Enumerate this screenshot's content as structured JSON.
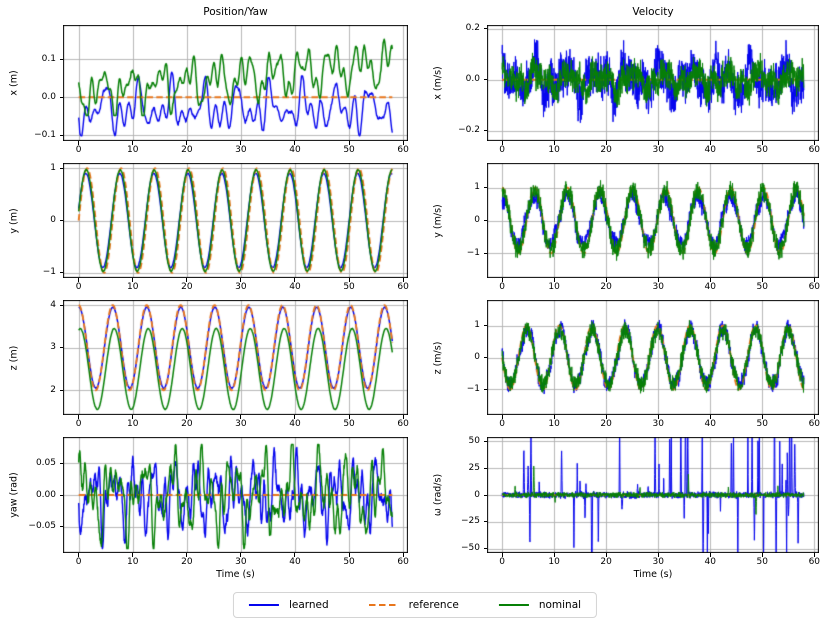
{
  "colors": {
    "learned": "#0505ee",
    "reference": "#e8761c",
    "nominal": "#078007",
    "grid": "#b0b0b0",
    "axis": "#000000"
  },
  "figure": {
    "xlabel": "Time (s)",
    "legend": [
      {
        "label": "learned",
        "color_key": "learned",
        "dashed": false
      },
      {
        "label": "reference",
        "color_key": "reference",
        "dashed": true
      },
      {
        "label": "nominal",
        "color_key": "nominal",
        "dashed": false
      }
    ]
  },
  "chart_data": [
    {
      "type": "line",
      "title": "Position/Yaw",
      "ylabel": "x (m)",
      "xlabel": null,
      "xlim": [
        -2.9,
        60.9
      ],
      "ylim": [
        -0.115,
        0.19
      ],
      "grid": true,
      "xticks": [
        0,
        10,
        20,
        30,
        40,
        50,
        60
      ],
      "yticks": [
        {
          "v": 0.1,
          "label": "0.1"
        },
        {
          "v": 0.0,
          "label": "0.0"
        },
        {
          "v": -0.1,
          "label": "−0.1"
        }
      ],
      "series": [
        {
          "name": "learned",
          "color_key": "learned",
          "width": 1.4,
          "dt": 0.1,
          "clamp": [
            -0.101,
            0.066
          ],
          "components": [
            {
              "type": "const",
              "value": -0.03
            },
            {
              "type": "wander",
              "amp": 0.04,
              "period": 6.2,
              "oct": 4,
              "seed": 11
            },
            {
              "type": "sine",
              "amp": 0.012,
              "omega": 1,
              "phase": 1.1
            },
            {
              "type": "noise",
              "amp": 0.003,
              "seed": 12
            }
          ]
        },
        {
          "name": "reference",
          "color_key": "reference",
          "width": 1.9,
          "dash": [
            6.5,
            3.2
          ],
          "dt": 0.5,
          "components": [
            {
              "type": "const",
              "value": 0
            }
          ]
        },
        {
          "name": "nominal",
          "color_key": "nominal",
          "width": 1.5,
          "dt": 0.1,
          "clamp": [
            -0.048,
            0.178
          ],
          "components": [
            {
              "type": "trend",
              "from": 0.01,
              "to": 0.09
            },
            {
              "type": "wander",
              "amp": 0.036,
              "period": 5.2,
              "oct": 4,
              "seed": 21
            },
            {
              "type": "noise",
              "amp": 0.003,
              "seed": 22
            }
          ]
        }
      ]
    },
    {
      "type": "line",
      "title": null,
      "ylabel": "y (m)",
      "xlabel": null,
      "xlim": [
        -2.9,
        60.9
      ],
      "ylim": [
        -1.1,
        1.1
      ],
      "grid": true,
      "xticks": [
        0,
        10,
        20,
        30,
        40,
        50,
        60
      ],
      "yticks": [
        {
          "v": 1,
          "label": "1"
        },
        {
          "v": 0,
          "label": "0"
        },
        {
          "v": -1,
          "label": "−1"
        }
      ],
      "series": [
        {
          "name": "learned",
          "color_key": "learned",
          "width": 1.4,
          "dt": 0.1,
          "components": [
            {
              "type": "sine",
              "amp": 0.9,
              "omega": 1,
              "phase": 0.25
            },
            {
              "type": "noise",
              "amp": 0.007,
              "seed": 31
            }
          ]
        },
        {
          "name": "reference",
          "color_key": "reference",
          "width": 1.9,
          "dash": [
            6.5,
            3.2
          ],
          "dt": 0.08,
          "components": [
            {
              "type": "sine",
              "amp": 1.0,
              "omega": 1,
              "phase": 0.0
            }
          ]
        },
        {
          "name": "nominal",
          "color_key": "nominal",
          "width": 1.5,
          "dt": 0.1,
          "components": [
            {
              "type": "sine",
              "amp": 0.97,
              "omega": 1,
              "phase": 0.18
            },
            {
              "type": "noise",
              "amp": 0.008,
              "seed": 32
            }
          ]
        }
      ]
    },
    {
      "type": "line",
      "title": null,
      "ylabel": "z (m)",
      "xlabel": null,
      "xlim": [
        -2.9,
        60.9
      ],
      "ylim": [
        1.42,
        4.12
      ],
      "grid": true,
      "xticks": [
        0,
        10,
        20,
        30,
        40,
        50,
        60
      ],
      "yticks": [
        {
          "v": 4,
          "label": "4"
        },
        {
          "v": 3,
          "label": "3"
        },
        {
          "v": 2,
          "label": "2"
        }
      ],
      "series": [
        {
          "name": "learned",
          "color_key": "learned",
          "width": 1.5,
          "dt": 0.1,
          "components": [
            {
              "type": "const",
              "value": 3
            },
            {
              "type": "sine",
              "amp": 0.95,
              "omega": 1,
              "phase": 1.53
            },
            {
              "type": "noise",
              "amp": 0.006,
              "seed": 33
            }
          ]
        },
        {
          "name": "reference",
          "color_key": "reference",
          "width": 1.9,
          "dash": [
            6.5,
            3.2
          ],
          "dt": 0.08,
          "components": [
            {
              "type": "const",
              "value": 3
            },
            {
              "type": "sine",
              "amp": 1.0,
              "omega": 1,
              "phase": 1.5708
            }
          ]
        },
        {
          "name": "nominal",
          "color_key": "nominal",
          "width": 1.5,
          "dt": 0.1,
          "components": [
            {
              "type": "const",
              "value": 2.5
            },
            {
              "type": "sine",
              "amp": 0.95,
              "omega": 1,
              "phase": 1.27
            },
            {
              "type": "noise",
              "amp": 0.006,
              "seed": 34
            }
          ]
        }
      ]
    },
    {
      "type": "line",
      "title": null,
      "ylabel": "yaw (rad)",
      "xlabel": "Time (s)",
      "xlim": [
        -2.9,
        60.9
      ],
      "ylim": [
        -0.092,
        0.092
      ],
      "grid": true,
      "xticks": [
        0,
        10,
        20,
        30,
        40,
        50,
        60
      ],
      "yticks": [
        {
          "v": 0.05,
          "label": "0.05"
        },
        {
          "v": 0.0,
          "label": "0.00"
        },
        {
          "v": -0.05,
          "label": "−0.05"
        }
      ],
      "series": [
        {
          "name": "learned",
          "color_key": "learned",
          "width": 1.4,
          "dt": 0.05,
          "clamp": [
            -0.085,
            0.083
          ],
          "components": [
            {
              "type": "wander",
              "amp": 0.03,
              "period": 4.2,
              "oct": 5,
              "seed": 41
            },
            {
              "type": "noise",
              "amp": 0.005,
              "seed": 42
            }
          ]
        },
        {
          "name": "reference",
          "color_key": "reference",
          "width": 1.9,
          "dash": [
            6.5,
            3.2
          ],
          "dt": 0.5,
          "components": [
            {
              "type": "const",
              "value": 0
            }
          ]
        },
        {
          "name": "nominal",
          "color_key": "nominal",
          "width": 1.4,
          "dt": 0.05,
          "clamp": [
            -0.085,
            0.08
          ],
          "components": [
            {
              "type": "wander",
              "amp": 0.034,
              "period": 4.8,
              "oct": 5,
              "seed": 51
            },
            {
              "type": "noise",
              "amp": 0.004,
              "seed": 52
            }
          ]
        }
      ]
    },
    {
      "type": "line",
      "title": "Velocity",
      "ylabel": "x (m/s)",
      "xlabel": null,
      "xlim": [
        -2.9,
        60.9
      ],
      "ylim": [
        -0.24,
        0.215
      ],
      "grid": true,
      "xticks": [
        0,
        10,
        20,
        30,
        40,
        50,
        60
      ],
      "yticks": [
        {
          "v": 0.2,
          "label": "0.2"
        },
        {
          "v": 0.0,
          "label": "0.0"
        },
        {
          "v": -0.2,
          "label": "−0.2"
        }
      ],
      "series": [
        {
          "name": "learned",
          "color_key": "learned",
          "width": 1.0,
          "dt": 0.04,
          "clamp": [
            -0.225,
            0.19
          ],
          "components": [
            {
              "type": "noise",
              "amp": 0.06,
              "seed": 61
            },
            {
              "type": "wander",
              "amp": 0.042,
              "period": 6.5,
              "oct": 3,
              "seed": 62
            }
          ]
        },
        {
          "name": "reference",
          "color_key": "reference",
          "width": 1.9,
          "dash": [
            6.5,
            3.2
          ],
          "dt": 0.5,
          "components": [
            {
              "type": "const",
              "value": 0
            }
          ]
        },
        {
          "name": "nominal",
          "color_key": "nominal",
          "width": 1.0,
          "dt": 0.04,
          "clamp": [
            -0.15,
            0.16
          ],
          "components": [
            {
              "type": "noise",
              "amp": 0.042,
              "seed": 71
            },
            {
              "type": "wander",
              "amp": 0.026,
              "period": 5.5,
              "oct": 3,
              "seed": 72
            }
          ]
        }
      ]
    },
    {
      "type": "line",
      "title": null,
      "ylabel": "y (m/s)",
      "xlabel": null,
      "xlim": [
        -2.9,
        60.9
      ],
      "ylim": [
        -1.75,
        1.75
      ],
      "grid": true,
      "xticks": [
        0,
        10,
        20,
        30,
        40,
        50,
        60
      ],
      "yticks": [
        {
          "v": 1,
          "label": "1"
        },
        {
          "v": 0,
          "label": "0"
        },
        {
          "v": -1,
          "label": "−1"
        }
      ],
      "series": [
        {
          "name": "learned",
          "color_key": "learned",
          "width": 1.0,
          "dt": 0.04,
          "components": [
            {
              "type": "sine",
              "amp": 0.72,
              "omega": 1,
              "phase": 1.72
            },
            {
              "type": "noise",
              "amp": 0.17,
              "seed": 81
            },
            {
              "type": "wander",
              "amp": 0.09,
              "period": 3.2,
              "oct": 2,
              "seed": 82
            }
          ]
        },
        {
          "name": "reference",
          "color_key": "reference",
          "width": 1.9,
          "dash": [
            6.5,
            3.2
          ],
          "dt": 0.08,
          "components": [
            {
              "type": "sine",
              "amp": 1.0,
              "omega": 1,
              "phase": 1.5708
            }
          ]
        },
        {
          "name": "nominal",
          "color_key": "nominal",
          "width": 1.0,
          "dt": 0.04,
          "components": [
            {
              "type": "sine",
              "amp": 0.9,
              "omega": 1,
              "phase": 1.62
            },
            {
              "type": "noise",
              "amp": 0.22,
              "seed": 83
            }
          ]
        }
      ]
    },
    {
      "type": "line",
      "title": null,
      "ylabel": "z (m/s)",
      "xlabel": null,
      "xlim": [
        -2.9,
        60.9
      ],
      "ylim": [
        -1.8,
        1.8
      ],
      "grid": true,
      "xticks": [
        0,
        10,
        20,
        30,
        40,
        50,
        60
      ],
      "yticks": [
        {
          "v": 1,
          "label": "1"
        },
        {
          "v": 0,
          "label": "0"
        },
        {
          "v": -1,
          "label": "−1"
        }
      ],
      "series": [
        {
          "name": "learned",
          "color_key": "learned",
          "width": 1.0,
          "dt": 0.04,
          "components": [
            {
              "type": "sine",
              "amp": 0.88,
              "omega": 1,
              "phase": 3.04
            },
            {
              "type": "noise",
              "amp": 0.18,
              "seed": 84
            },
            {
              "type": "wander",
              "amp": 0.08,
              "period": 3.0,
              "oct": 2,
              "seed": 85
            }
          ]
        },
        {
          "name": "reference",
          "color_key": "reference",
          "width": 1.9,
          "dash": [
            6.5,
            3.2
          ],
          "dt": 0.08,
          "components": [
            {
              "type": "sine",
              "amp": 1.0,
              "omega": 1,
              "phase": 3.1416
            }
          ]
        },
        {
          "name": "nominal",
          "color_key": "nominal",
          "width": 1.0,
          "dt": 0.04,
          "components": [
            {
              "type": "sine",
              "amp": 0.85,
              "omega": 1,
              "phase": 3.09
            },
            {
              "type": "noise",
              "amp": 0.2,
              "seed": 86
            }
          ]
        }
      ]
    },
    {
      "type": "line",
      "title": null,
      "ylabel": "ω (rad/s)",
      "xlabel": "Time (s)",
      "xlim": [
        -2.9,
        60.9
      ],
      "ylim": [
        -54,
        54
      ],
      "grid": true,
      "xticks": [
        0,
        10,
        20,
        30,
        40,
        50,
        60
      ],
      "yticks": [
        {
          "v": 50,
          "label": "50"
        },
        {
          "v": 25,
          "label": "25"
        },
        {
          "v": 0,
          "label": "0"
        },
        {
          "v": -25,
          "label": "−25"
        },
        {
          "v": -50,
          "label": "−50"
        }
      ],
      "series": [
        {
          "name": "learned",
          "color_key": "learned",
          "width": 1.0,
          "dt": 0.04,
          "components": [
            {
              "type": "noise",
              "amp": 2.2,
              "seed": 91
            },
            {
              "type": "spikes",
              "seed": 92,
              "count": 58,
              "hmin": 8,
              "hmax": 90,
              "tmin": 1.5,
              "tmax": 57,
              "bias": 0.7,
              "negFrac": 0.45
            }
          ]
        },
        {
          "name": "reference",
          "color_key": "reference",
          "width": 2.2,
          "dash": [
            6.5,
            3.2
          ],
          "dt": 0.5,
          "components": [
            {
              "type": "const",
              "value": 0
            }
          ]
        },
        {
          "name": "nominal",
          "color_key": "nominal",
          "width": 1.0,
          "dt": 0.04,
          "components": [
            {
              "type": "noise",
              "amp": 1.8,
              "seed": 95
            },
            {
              "type": "spikelist",
              "spikes": [
                [
                  6.1,
                  31,
                  0.12
                ],
                [
                  35.8,
                  20,
                  0.1
                ],
                [
                  48.8,
                  -20,
                  0.12
                ],
                [
                  2.5,
                  9,
                  0.1
                ],
                [
                  10.2,
                  -8,
                  0.08
                ],
                [
                  26.5,
                  8,
                  0.08
                ],
                [
                  43.5,
                  8,
                  0.08
                ],
                [
                  53.0,
                  9,
                  0.08
                ]
              ]
            }
          ]
        }
      ]
    }
  ]
}
